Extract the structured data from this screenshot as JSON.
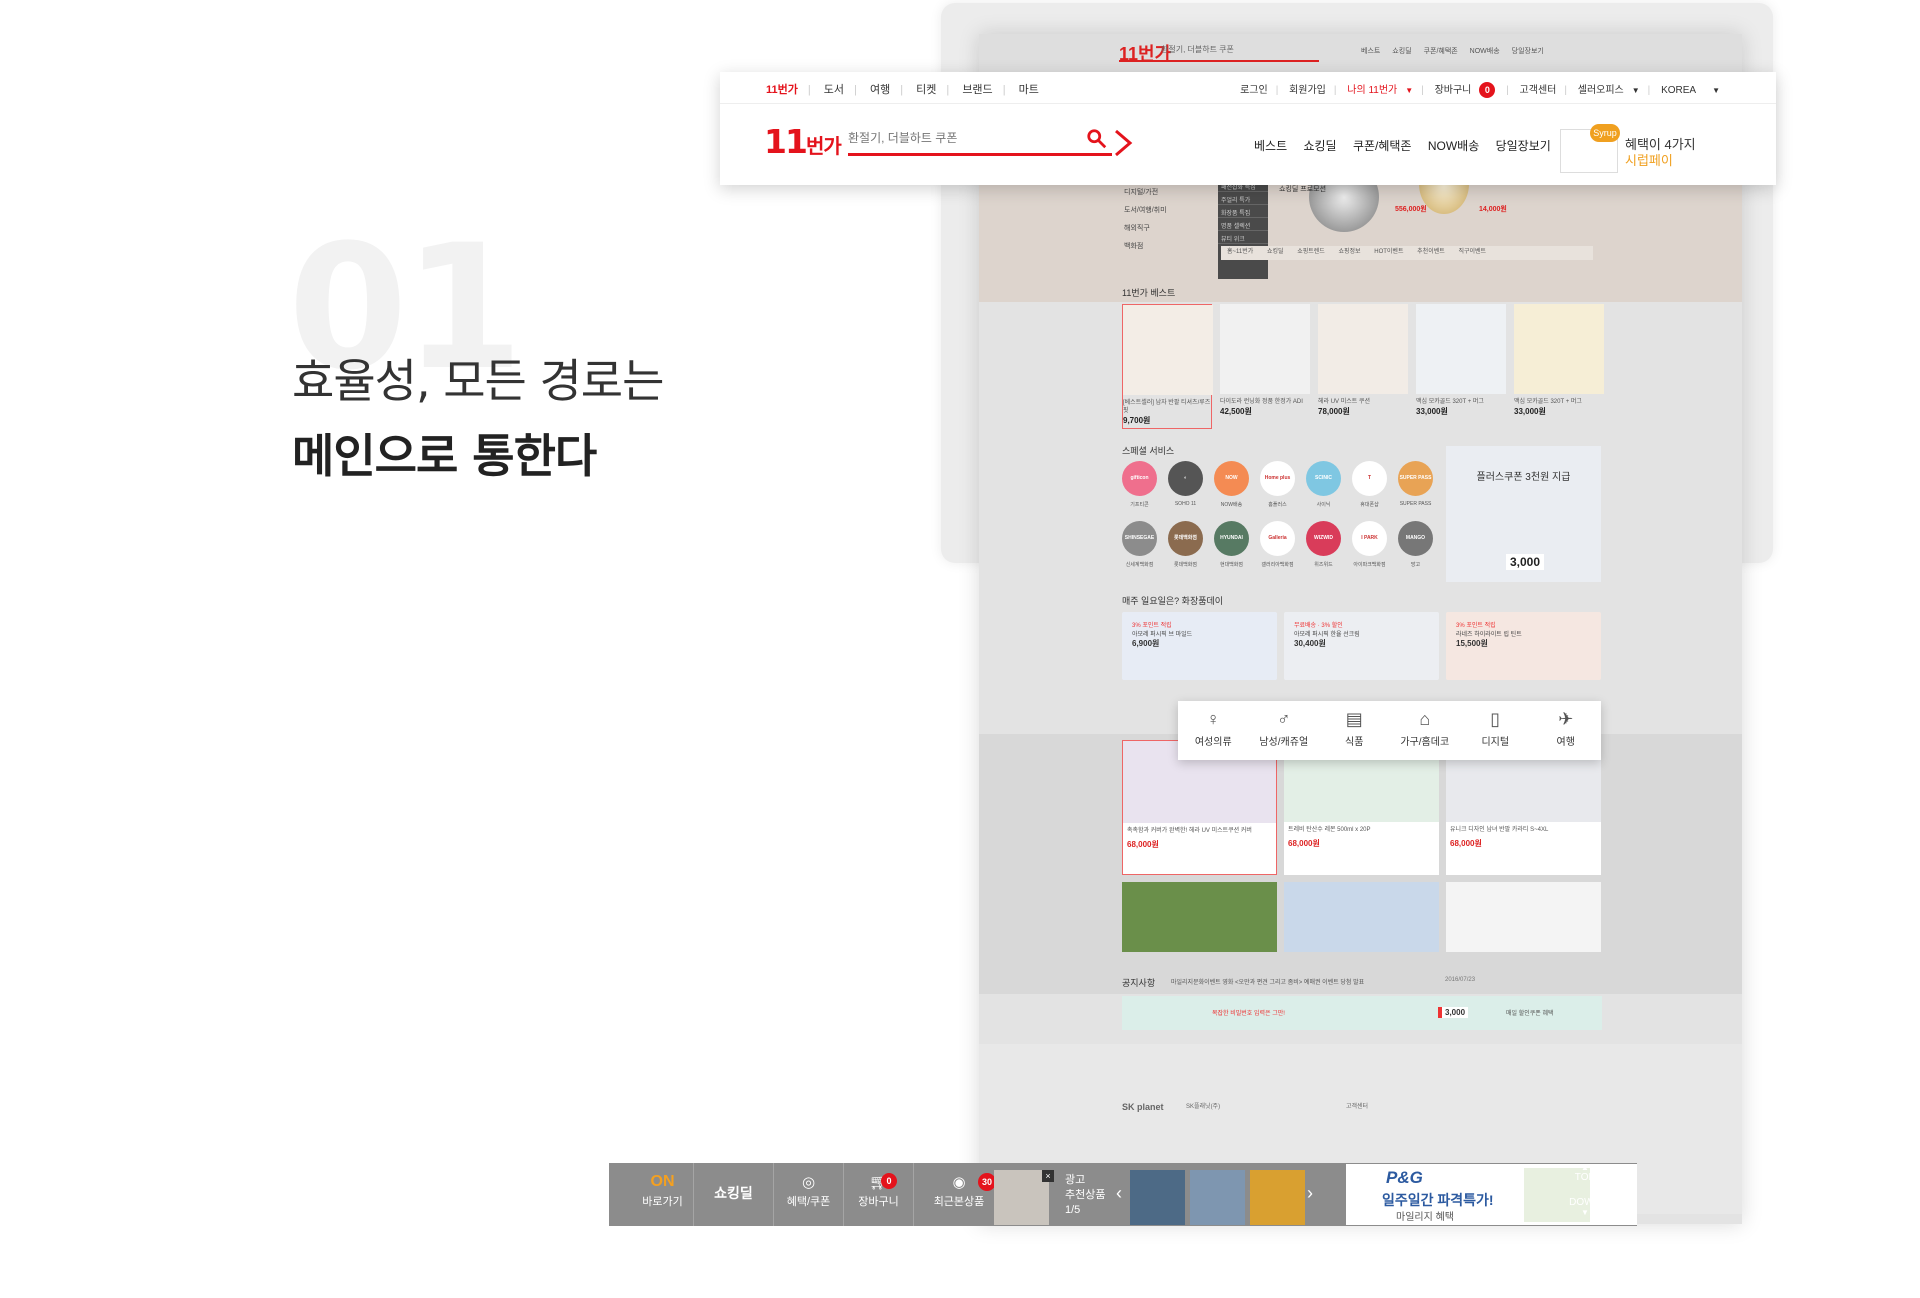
{
  "intro": {
    "number": "01",
    "line1": "효율성, 모든 경로는",
    "line2": "메인으로 통한다"
  },
  "header": {
    "top_left": [
      "11번가",
      "도서",
      "여행",
      "티켓",
      "브랜드",
      "마트"
    ],
    "top_right": [
      "로그인",
      "회원가입",
      "나의 11번가",
      "장바구니",
      "0",
      "고객센터",
      "셀러오피스",
      "KOREA"
    ],
    "logo_num": "11",
    "logo_text": "번가",
    "search_placeholder": "환절기, 더블하트 쿠폰",
    "nav": [
      "베스트",
      "쇼킹딜",
      "쿠폰/혜택존",
      "NOW배송",
      "당일장보기"
    ],
    "syrup_badge": "Syrup",
    "syrup_line1": "혜택이 4가지",
    "syrup_line2": "시럽페이"
  },
  "mini": {
    "logo": "11번가",
    "search": "환절기, 더블하트 쿠폰",
    "nav": [
      "베스트",
      "쇼킹딜",
      "쿠폰/혜택존",
      "NOW배송",
      "당일장보기"
    ]
  },
  "hero": {
    "menu": [
      "디지털/가전",
      "도서/여행/취미",
      "해외직구",
      "백화점"
    ],
    "dark": [
      "패션잡화 특집",
      "주얼리 특가",
      "화장품 특집",
      "명품 셀렉션",
      "뷰티 위크"
    ],
    "promo": "쇼킹딜 프로모션",
    "price1": "556,000원",
    "price2": "14,000원",
    "tabs": [
      "홈~11번가",
      "쇼킹딜",
      "쇼핑트렌드",
      "쇼핑정보",
      "HOT이벤트",
      "추천이벤트",
      "직구이벤트"
    ]
  },
  "best": {
    "title": "11번가 베스트",
    "products": [
      {
        "rank": "1",
        "text": "[베스트셀러] 남자 반팔 티셔츠/루즈핏",
        "price": "9,700원"
      },
      {
        "rank": "2",
        "text": "다이도라 런닝화 정품 한정가 ADI",
        "price": "42,500원"
      },
      {
        "rank": "3",
        "text": "헤라 UV 미스트 쿠션",
        "price": "78,000원"
      },
      {
        "rank": "4",
        "text": "맥심 모카골드 320T + 머그",
        "price": "33,000원"
      },
      {
        "rank": "5",
        "text": "맥심 모카골드 320T + 머그",
        "price": "33,000원"
      }
    ]
  },
  "special": {
    "title": "스페셜 서비스",
    "row1": [
      {
        "label": "기프티콘",
        "text": "gifticon",
        "color": "#ef6f8d"
      },
      {
        "label": "SOHO 11",
        "text": "◐",
        "color": "#555555"
      },
      {
        "label": "NOW배송",
        "text": "NOW",
        "color": "#f48b53"
      },
      {
        "label": "홈플러스",
        "text": "Home plus",
        "color": "#ffffff"
      },
      {
        "label": "사이닉",
        "text": "SCINIC",
        "color": "#7fc7e2"
      },
      {
        "label": "휴대폰샵",
        "text": "T",
        "color": "#ffffff"
      },
      {
        "label": "SUPER PASS",
        "text": "SUPER PASS",
        "color": "#e8a355"
      }
    ],
    "row2": [
      {
        "label": "신세계백화점",
        "text": "SHINSEGAE",
        "color": "#8c8c8c"
      },
      {
        "label": "롯데백화점",
        "text": "롯데백화점",
        "color": "#8b6b4f"
      },
      {
        "label": "현대백화점",
        "text": "HYUNDAI",
        "color": "#577a63"
      },
      {
        "label": "갤러리아백화점",
        "text": "Galleria",
        "color": "#ffffff"
      },
      {
        "label": "위즈위드",
        "text": "WIZWID",
        "color": "#d93c5a"
      },
      {
        "label": "아이파크백화점",
        "text": "I PARK",
        "color": "#ffffff"
      },
      {
        "label": "망고",
        "text": "MANGO",
        "color": "#777777"
      }
    ],
    "ad_title": "플러스쿠폰 3천원 지급",
    "ad_price": "3,000"
  },
  "weekly": {
    "title": "매주 일요일은? 화장품데이",
    "items": [
      {
        "tag": "3% 포인트 적립",
        "text": "아모레 퍼시픽 브 마일드",
        "price": "6,900원"
      },
      {
        "tag": "무료배송 · 3% 할인",
        "text": "아모레 퍼시픽 한율 선크림",
        "price": "30,400원"
      },
      {
        "tag": "3% 포인트 적립",
        "text": "라네즈 하이라이트 립 틴트",
        "price": "15,500원"
      }
    ]
  },
  "categories": [
    {
      "icon": "♀",
      "label": "여성의류"
    },
    {
      "icon": "♂",
      "label": "남성/캐쥬얼"
    },
    {
      "icon": "▤",
      "label": "식품"
    },
    {
      "icon": "⌂",
      "label": "가구/홈데코"
    },
    {
      "icon": "▯",
      "label": "디지털"
    },
    {
      "icon": "✈",
      "label": "여행"
    }
  ],
  "deals": [
    {
      "text": "촉촉함과 커버가 완벽한! 헤라 UV 미스트쿠션 커버",
      "price": "68,000원"
    },
    {
      "text": "트레비 탄산수 레몬 500ml x 20P",
      "price": "68,000원"
    },
    {
      "text": "유니크 디자인 남녀 반팔 카라티 S~4XL",
      "price": "68,000원"
    }
  ],
  "notice": {
    "title": "공지사항",
    "text": "마일리지문화이벤트 영화 <오만과 편견 그리고 좀비> 예매권 이벤트 당첨 발표",
    "date": "2016/07/23"
  },
  "banner": {
    "left": "복잡한 비밀번호 입력은 그만!",
    "price": "3,000",
    "right": "매일 할인쿠폰 혜택"
  },
  "footer": {
    "company": "SK플래닛(주)",
    "cs": "고객센터",
    "brand": "SK planet"
  },
  "bottombar": {
    "on": "ON",
    "shortcut": "바로가기",
    "shocking": "쇼킹딜",
    "benefit": "혜택/쿠폰",
    "cart": "장바구니",
    "cart_count": "0",
    "recent": "최근본상품",
    "recent_count": "30",
    "ad": "광고",
    "rec": "추천상품",
    "page": "1/5",
    "pg_brand": "P&G",
    "pg_title": "일주일간 파격특가!",
    "pg_sub": "마일리지 혜택",
    "top": "TOP",
    "down": "DOWN"
  }
}
